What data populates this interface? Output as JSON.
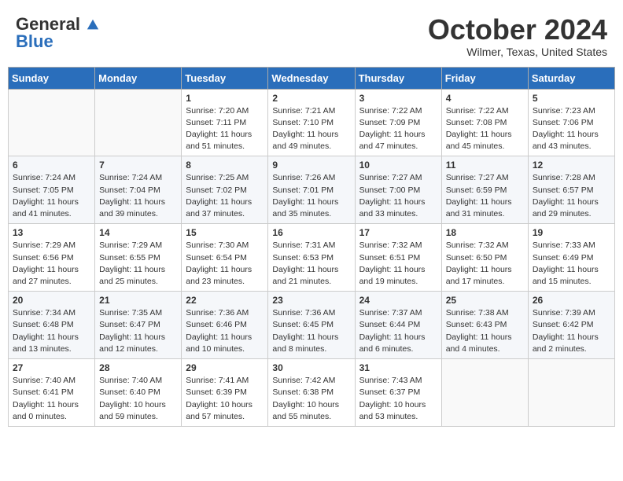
{
  "header": {
    "logo_general": "General",
    "logo_blue": "Blue",
    "month_title": "October 2024",
    "location": "Wilmer, Texas, United States"
  },
  "days_of_week": [
    "Sunday",
    "Monday",
    "Tuesday",
    "Wednesday",
    "Thursday",
    "Friday",
    "Saturday"
  ],
  "weeks": [
    [
      {
        "day": "",
        "sunrise": "",
        "sunset": "",
        "daylight": ""
      },
      {
        "day": "",
        "sunrise": "",
        "sunset": "",
        "daylight": ""
      },
      {
        "day": "1",
        "sunrise": "Sunrise: 7:20 AM",
        "sunset": "Sunset: 7:11 PM",
        "daylight": "Daylight: 11 hours and 51 minutes."
      },
      {
        "day": "2",
        "sunrise": "Sunrise: 7:21 AM",
        "sunset": "Sunset: 7:10 PM",
        "daylight": "Daylight: 11 hours and 49 minutes."
      },
      {
        "day": "3",
        "sunrise": "Sunrise: 7:22 AM",
        "sunset": "Sunset: 7:09 PM",
        "daylight": "Daylight: 11 hours and 47 minutes."
      },
      {
        "day": "4",
        "sunrise": "Sunrise: 7:22 AM",
        "sunset": "Sunset: 7:08 PM",
        "daylight": "Daylight: 11 hours and 45 minutes."
      },
      {
        "day": "5",
        "sunrise": "Sunrise: 7:23 AM",
        "sunset": "Sunset: 7:06 PM",
        "daylight": "Daylight: 11 hours and 43 minutes."
      }
    ],
    [
      {
        "day": "6",
        "sunrise": "Sunrise: 7:24 AM",
        "sunset": "Sunset: 7:05 PM",
        "daylight": "Daylight: 11 hours and 41 minutes."
      },
      {
        "day": "7",
        "sunrise": "Sunrise: 7:24 AM",
        "sunset": "Sunset: 7:04 PM",
        "daylight": "Daylight: 11 hours and 39 minutes."
      },
      {
        "day": "8",
        "sunrise": "Sunrise: 7:25 AM",
        "sunset": "Sunset: 7:02 PM",
        "daylight": "Daylight: 11 hours and 37 minutes."
      },
      {
        "day": "9",
        "sunrise": "Sunrise: 7:26 AM",
        "sunset": "Sunset: 7:01 PM",
        "daylight": "Daylight: 11 hours and 35 minutes."
      },
      {
        "day": "10",
        "sunrise": "Sunrise: 7:27 AM",
        "sunset": "Sunset: 7:00 PM",
        "daylight": "Daylight: 11 hours and 33 minutes."
      },
      {
        "day": "11",
        "sunrise": "Sunrise: 7:27 AM",
        "sunset": "Sunset: 6:59 PM",
        "daylight": "Daylight: 11 hours and 31 minutes."
      },
      {
        "day": "12",
        "sunrise": "Sunrise: 7:28 AM",
        "sunset": "Sunset: 6:57 PM",
        "daylight": "Daylight: 11 hours and 29 minutes."
      }
    ],
    [
      {
        "day": "13",
        "sunrise": "Sunrise: 7:29 AM",
        "sunset": "Sunset: 6:56 PM",
        "daylight": "Daylight: 11 hours and 27 minutes."
      },
      {
        "day": "14",
        "sunrise": "Sunrise: 7:29 AM",
        "sunset": "Sunset: 6:55 PM",
        "daylight": "Daylight: 11 hours and 25 minutes."
      },
      {
        "day": "15",
        "sunrise": "Sunrise: 7:30 AM",
        "sunset": "Sunset: 6:54 PM",
        "daylight": "Daylight: 11 hours and 23 minutes."
      },
      {
        "day": "16",
        "sunrise": "Sunrise: 7:31 AM",
        "sunset": "Sunset: 6:53 PM",
        "daylight": "Daylight: 11 hours and 21 minutes."
      },
      {
        "day": "17",
        "sunrise": "Sunrise: 7:32 AM",
        "sunset": "Sunset: 6:51 PM",
        "daylight": "Daylight: 11 hours and 19 minutes."
      },
      {
        "day": "18",
        "sunrise": "Sunrise: 7:32 AM",
        "sunset": "Sunset: 6:50 PM",
        "daylight": "Daylight: 11 hours and 17 minutes."
      },
      {
        "day": "19",
        "sunrise": "Sunrise: 7:33 AM",
        "sunset": "Sunset: 6:49 PM",
        "daylight": "Daylight: 11 hours and 15 minutes."
      }
    ],
    [
      {
        "day": "20",
        "sunrise": "Sunrise: 7:34 AM",
        "sunset": "Sunset: 6:48 PM",
        "daylight": "Daylight: 11 hours and 13 minutes."
      },
      {
        "day": "21",
        "sunrise": "Sunrise: 7:35 AM",
        "sunset": "Sunset: 6:47 PM",
        "daylight": "Daylight: 11 hours and 12 minutes."
      },
      {
        "day": "22",
        "sunrise": "Sunrise: 7:36 AM",
        "sunset": "Sunset: 6:46 PM",
        "daylight": "Daylight: 11 hours and 10 minutes."
      },
      {
        "day": "23",
        "sunrise": "Sunrise: 7:36 AM",
        "sunset": "Sunset: 6:45 PM",
        "daylight": "Daylight: 11 hours and 8 minutes."
      },
      {
        "day": "24",
        "sunrise": "Sunrise: 7:37 AM",
        "sunset": "Sunset: 6:44 PM",
        "daylight": "Daylight: 11 hours and 6 minutes."
      },
      {
        "day": "25",
        "sunrise": "Sunrise: 7:38 AM",
        "sunset": "Sunset: 6:43 PM",
        "daylight": "Daylight: 11 hours and 4 minutes."
      },
      {
        "day": "26",
        "sunrise": "Sunrise: 7:39 AM",
        "sunset": "Sunset: 6:42 PM",
        "daylight": "Daylight: 11 hours and 2 minutes."
      }
    ],
    [
      {
        "day": "27",
        "sunrise": "Sunrise: 7:40 AM",
        "sunset": "Sunset: 6:41 PM",
        "daylight": "Daylight: 11 hours and 0 minutes."
      },
      {
        "day": "28",
        "sunrise": "Sunrise: 7:40 AM",
        "sunset": "Sunset: 6:40 PM",
        "daylight": "Daylight: 10 hours and 59 minutes."
      },
      {
        "day": "29",
        "sunrise": "Sunrise: 7:41 AM",
        "sunset": "Sunset: 6:39 PM",
        "daylight": "Daylight: 10 hours and 57 minutes."
      },
      {
        "day": "30",
        "sunrise": "Sunrise: 7:42 AM",
        "sunset": "Sunset: 6:38 PM",
        "daylight": "Daylight: 10 hours and 55 minutes."
      },
      {
        "day": "31",
        "sunrise": "Sunrise: 7:43 AM",
        "sunset": "Sunset: 6:37 PM",
        "daylight": "Daylight: 10 hours and 53 minutes."
      },
      {
        "day": "",
        "sunrise": "",
        "sunset": "",
        "daylight": ""
      },
      {
        "day": "",
        "sunrise": "",
        "sunset": "",
        "daylight": ""
      }
    ]
  ]
}
